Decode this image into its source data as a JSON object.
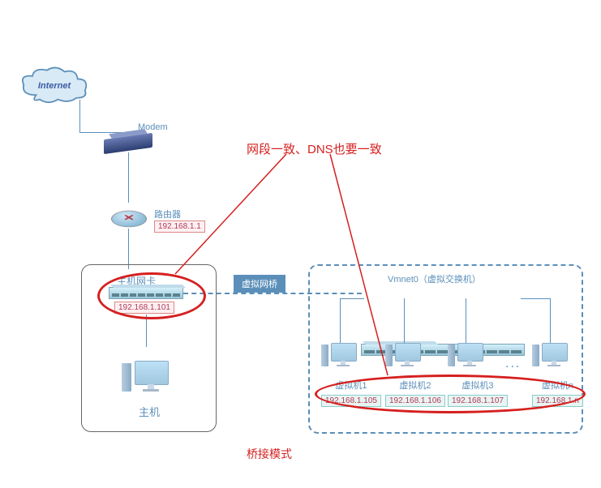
{
  "diagram": {
    "title": "桥接模式",
    "annotation": "网段一致、DNS也要一致",
    "internet": {
      "label": "Internet"
    },
    "modem": {
      "label": "Modem"
    },
    "router": {
      "label": "路由器",
      "ip": "192.168.1.1"
    },
    "host": {
      "nic_label": "主机网卡",
      "nic_ip": "192.168.1.101",
      "label": "主机"
    },
    "bridge": {
      "label": "虚拟网桥"
    },
    "vswitch": {
      "label": "Vmnet0（虚拟交换机）"
    },
    "vms": [
      {
        "name": "虚拟机1",
        "ip": "192.168.1.105"
      },
      {
        "name": "虚拟机2",
        "ip": "192.168.1.106"
      },
      {
        "name": "虚拟机3",
        "ip": "192.168.1.107"
      },
      {
        "name": "虚拟机n",
        "ip": "192.168.1.n"
      }
    ],
    "ellipsis": "..."
  }
}
